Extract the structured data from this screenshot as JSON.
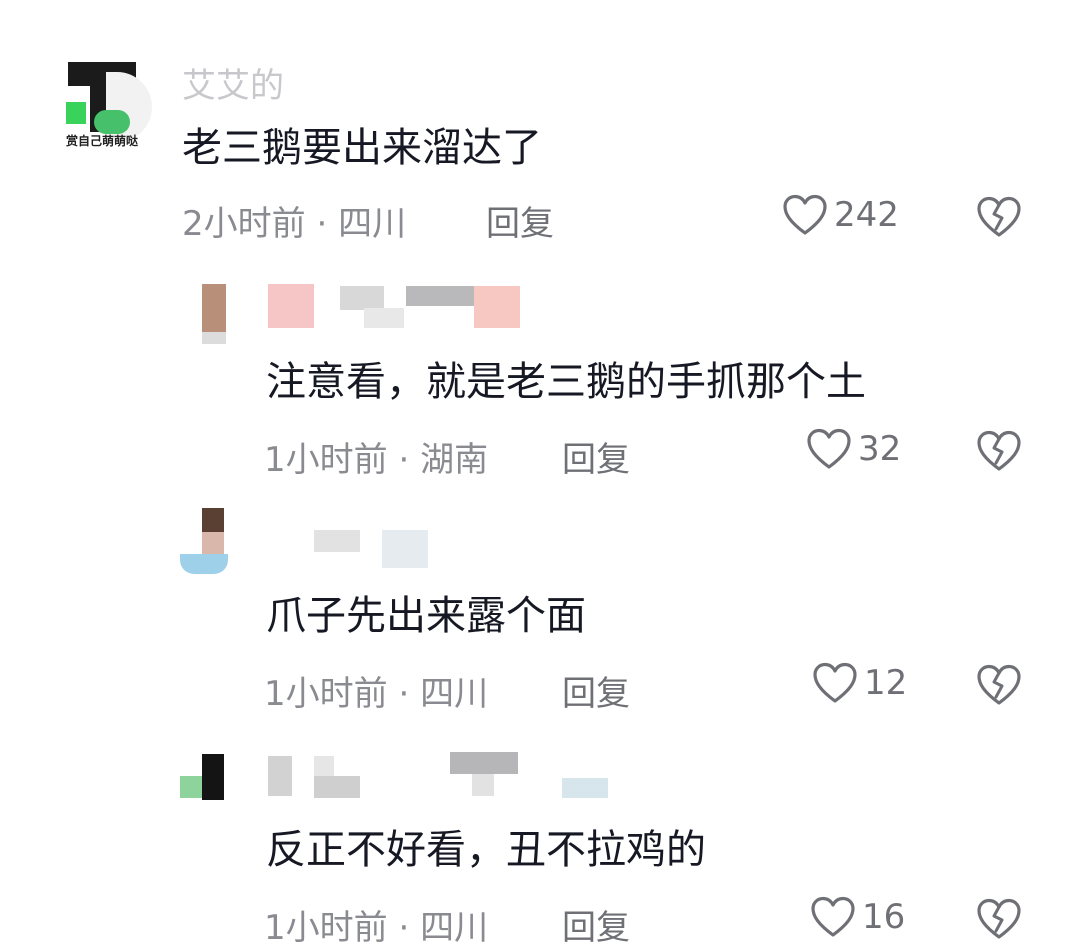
{
  "comments": [
    {
      "username": "艾艾的",
      "text": "老三鹅要出来溜达了",
      "time": "2小时前",
      "location": "四川",
      "reply_label": "回复",
      "likes": "242",
      "avatar_badge": "赏自己萌萌哒"
    },
    {
      "username": "",
      "text": "注意看，就是老三鹅的手抓那个土",
      "time": "1小时前",
      "location": "湖南",
      "reply_label": "回复",
      "likes": "32"
    },
    {
      "username": "",
      "text": "爪子先出来露个面",
      "time": "1小时前",
      "location": "四川",
      "reply_label": "回复",
      "likes": "12"
    },
    {
      "username": "",
      "text": "反正不好看，丑不拉鸡的",
      "time": "1小时前",
      "location": "四川",
      "reply_label": "回复",
      "likes": "16"
    }
  ],
  "separator": "·",
  "icons": {
    "like": "heart-outline-icon",
    "dislike": "broken-heart-icon"
  },
  "colors": {
    "text": "#161823",
    "meta": "#8a8b91",
    "icon": "#6f7076"
  }
}
